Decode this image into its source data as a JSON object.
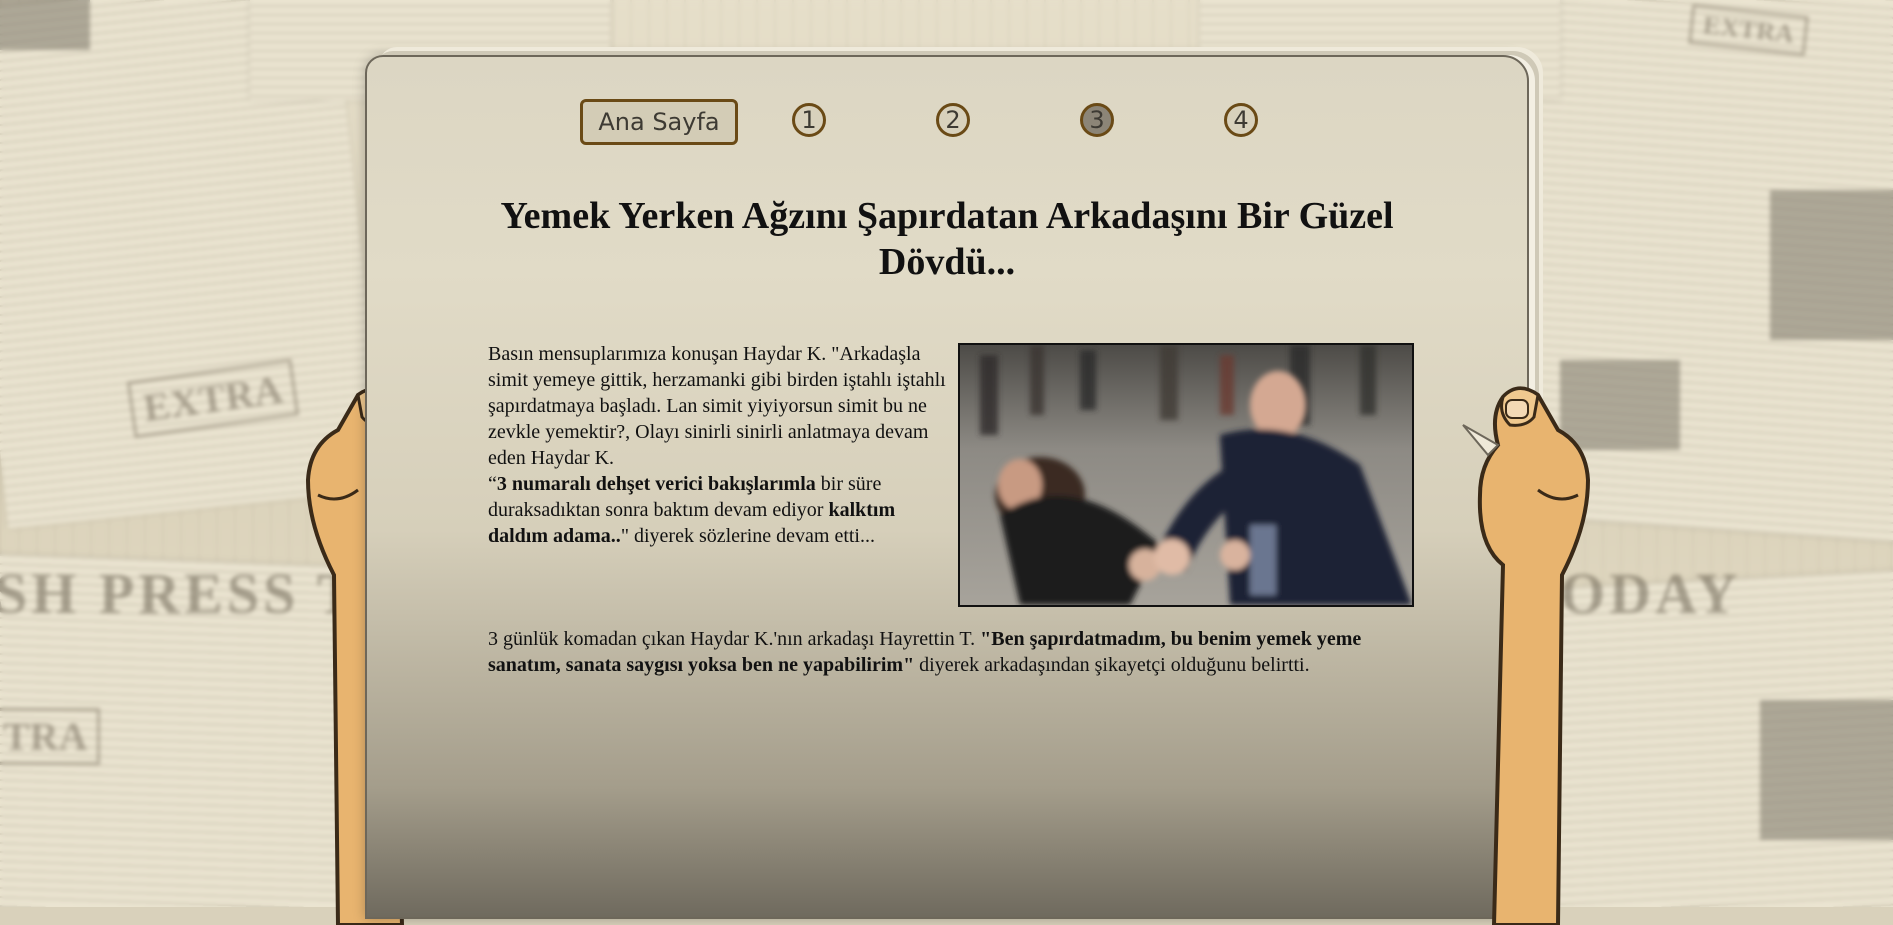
{
  "nav": {
    "home_label": "Ana Sayfa",
    "pages": [
      "1",
      "2",
      "3",
      "4"
    ],
    "active_page": "3"
  },
  "article": {
    "headline": "Yemek Yerken Ağzını Şapırdatan Arkadaşını Bir Güzel Dövdü...",
    "p1": "Basın mensuplarımıza konuşan Haydar K. \"Arkadaşla simit yemeye gittik, herzamanki gibi birden iştahlı iştahlı şapırdatmaya başladı. Lan simit yiyiyorsun simit bu ne zevkle yemektir?, Olayı sinirli sinirli anlatmaya devam eden Haydar K.",
    "p2_open": "“",
    "p2_bold1": "3 numaralı dehşet verici bakışlarımla",
    "p2_mid": " bir süre duraksadıktan sonra baktım devam ediyor ",
    "p2_bold2": "kalktım daldım adama..",
    "p2_end": "\" diyerek sözlerine devam etti...",
    "p3_start": "3 günlük komadan çıkan Haydar K.'nın arkadaşı Hayrettin T. ",
    "p3_bold": "\"Ben şapırdatmadım, bu benim yemek yeme sanatım, sanata saygısı yoksa ben ne yapabilirim\"",
    "p3_end": " diyerek arkadaşından şikayetçi olduğunu belirtti.",
    "photo": "fight-photo"
  },
  "background": {
    "words": [
      "SH PRESS T",
      "ODAY",
      "EXTRA",
      "EXTRA",
      "TRA"
    ]
  }
}
